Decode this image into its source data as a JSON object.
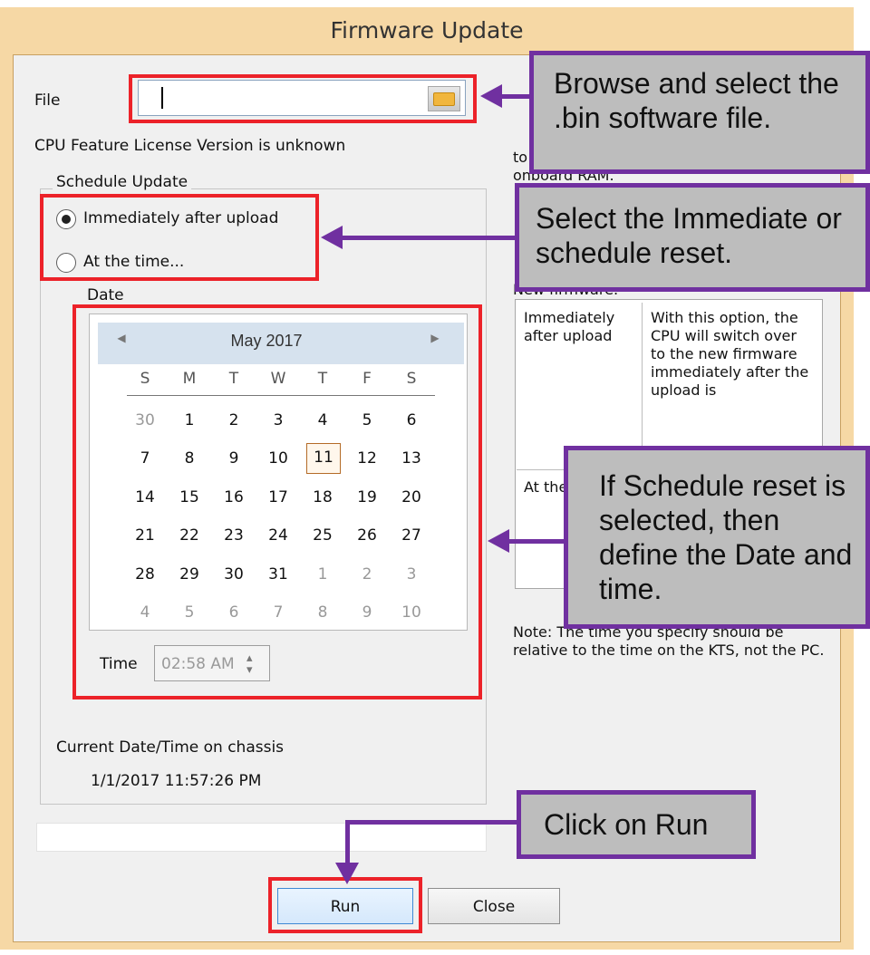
{
  "dialog": {
    "title": "Firmware Update",
    "file_label": "File",
    "license_text": "CPU Feature License Version is unknown",
    "schedule_group_label": "Schedule Update",
    "radio_options": [
      {
        "label": "Immediately after upload",
        "selected": true
      },
      {
        "label": "At the time...",
        "selected": false
      }
    ],
    "date_label": "Date",
    "time_label": "Time",
    "time_value": "02:58 AM",
    "current_datetime_label": "Current Date/Time on chassis",
    "current_datetime_value": "1/1/2017 11:57:26 PM",
    "buttons": {
      "run": "Run",
      "close": "Close"
    }
  },
  "calendar": {
    "month": "May 2017",
    "weekdays": [
      "S",
      "M",
      "T",
      "W",
      "T",
      "F",
      "S"
    ],
    "weeks": [
      [
        "30",
        "1",
        "2",
        "3",
        "4",
        "5",
        "6"
      ],
      [
        "7",
        "8",
        "9",
        "10",
        "11",
        "12",
        "13"
      ],
      [
        "14",
        "15",
        "16",
        "17",
        "18",
        "19",
        "20"
      ],
      [
        "21",
        "22",
        "23",
        "24",
        "25",
        "26",
        "27"
      ],
      [
        "28",
        "29",
        "30",
        "31",
        "1",
        "2",
        "3"
      ],
      [
        "4",
        "5",
        "6",
        "7",
        "8",
        "9",
        "10"
      ]
    ],
    "selected_day": "11"
  },
  "right_panel": {
    "partial_text": "to the KTS. The file will be copied to the onboard RAM.",
    "partial_note_header": "New firmware:",
    "table": {
      "row1_col1": "Immediately after upload",
      "row1_col2": "With this option, the CPU will switch over to the new firmware immediately after the upload is",
      "row2_col1": "At the time."
    },
    "note": "Note: The time you specify should be relative to the time on the KTS, not the PC."
  },
  "callouts": {
    "browse": "Browse and select the .bin software file.",
    "schedule": "Select the Immediate or schedule reset.",
    "date_time": "If Schedule reset is selected, then define the Date and time.",
    "run": "Click on Run"
  },
  "colors": {
    "callout_fill": "#bdbdbd",
    "callout_border": "#7030a0",
    "highlight_red": "#ec2229",
    "dialog_frame": "#f6d8a5"
  },
  "icons": {
    "browse": "folder-icon",
    "calendar_previous": "left-triangle-icon",
    "calendar_next": "right-triangle-icon",
    "time_spinner": "up-down-spinner-icon"
  }
}
